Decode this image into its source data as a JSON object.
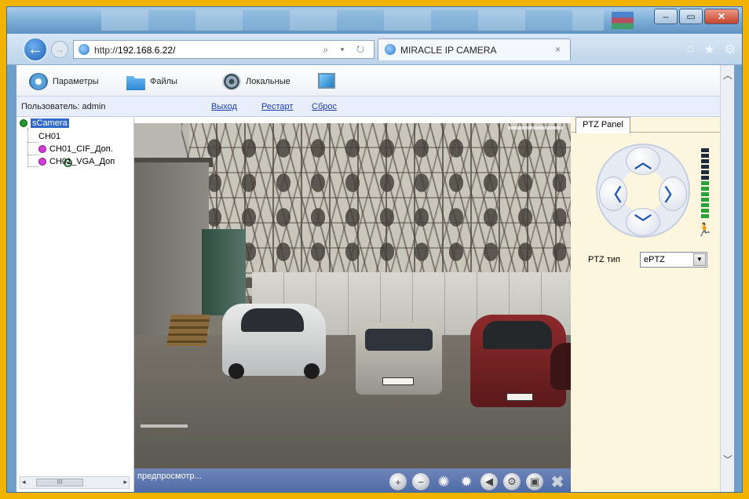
{
  "browser": {
    "url_prefix": "http://",
    "url_host": "192.168.6.22/",
    "address_tools": "⌕ ▾ ↻",
    "tab_title": "MIRACLE IP CAMERA",
    "tab_close": "×",
    "window_buttons": {
      "minimize": "‒",
      "maximize": "▭",
      "close": "✕"
    },
    "nav_icons": {
      "home": "⌂",
      "favorites": "★",
      "settings": "⚙"
    },
    "back": "←",
    "forward": "→"
  },
  "toolbar": {
    "params_label": "Параметры",
    "files_label": "Файлы",
    "local_label": "Локальные"
  },
  "userbar": {
    "user_text": "Пользователь: admin",
    "logout": "Выход",
    "restart": "Рестарт",
    "reset": "Сброс"
  },
  "tree": {
    "root": "sCamera",
    "items": [
      {
        "label": "CH01"
      },
      {
        "label": "CH01_CIF_Доп."
      },
      {
        "label": "CH01_VGA_Доп"
      }
    ],
    "scroll_thumb": "III"
  },
  "video": {
    "status": "предпросмотр...",
    "controls": [
      "record-add",
      "record-remove",
      "brightness-up",
      "brightness-down",
      "sound",
      "settings",
      "snapshot",
      "close"
    ]
  },
  "ptz": {
    "tab": "PTZ Panel",
    "type_label": "PTZ тип",
    "type_value": "ePTZ",
    "arrows": {
      "up": "︿",
      "down": "﹀",
      "left": "〈",
      "right": "〉"
    },
    "speed_level": 0.5
  },
  "colors": {
    "frame": "#f2b200",
    "selected": "#3169c6",
    "link": "#1a3db4",
    "ptz_bg": "#fbf6dd",
    "video_bar": "#4e6aa6"
  }
}
